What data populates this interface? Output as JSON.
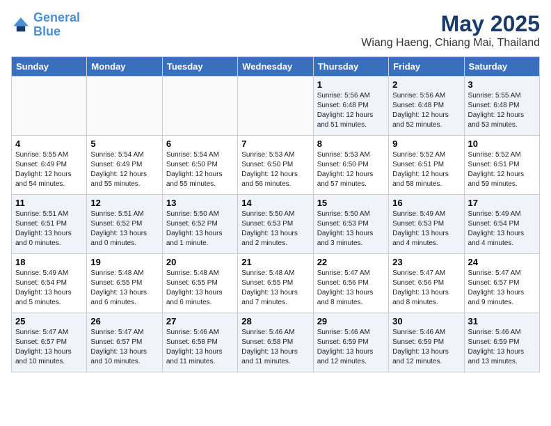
{
  "logo": {
    "line1": "General",
    "line2": "Blue"
  },
  "title": "May 2025",
  "subtitle": "Wiang Haeng, Chiang Mai, Thailand",
  "days_of_week": [
    "Sunday",
    "Monday",
    "Tuesday",
    "Wednesday",
    "Thursday",
    "Friday",
    "Saturday"
  ],
  "weeks": [
    [
      {
        "day": "",
        "info": ""
      },
      {
        "day": "",
        "info": ""
      },
      {
        "day": "",
        "info": ""
      },
      {
        "day": "",
        "info": ""
      },
      {
        "day": "1",
        "info": "Sunrise: 5:56 AM\nSunset: 6:48 PM\nDaylight: 12 hours and 51 minutes."
      },
      {
        "day": "2",
        "info": "Sunrise: 5:56 AM\nSunset: 6:48 PM\nDaylight: 12 hours and 52 minutes."
      },
      {
        "day": "3",
        "info": "Sunrise: 5:55 AM\nSunset: 6:48 PM\nDaylight: 12 hours and 53 minutes."
      }
    ],
    [
      {
        "day": "4",
        "info": "Sunrise: 5:55 AM\nSunset: 6:49 PM\nDaylight: 12 hours and 54 minutes."
      },
      {
        "day": "5",
        "info": "Sunrise: 5:54 AM\nSunset: 6:49 PM\nDaylight: 12 hours and 55 minutes."
      },
      {
        "day": "6",
        "info": "Sunrise: 5:54 AM\nSunset: 6:50 PM\nDaylight: 12 hours and 55 minutes."
      },
      {
        "day": "7",
        "info": "Sunrise: 5:53 AM\nSunset: 6:50 PM\nDaylight: 12 hours and 56 minutes."
      },
      {
        "day": "8",
        "info": "Sunrise: 5:53 AM\nSunset: 6:50 PM\nDaylight: 12 hours and 57 minutes."
      },
      {
        "day": "9",
        "info": "Sunrise: 5:52 AM\nSunset: 6:51 PM\nDaylight: 12 hours and 58 minutes."
      },
      {
        "day": "10",
        "info": "Sunrise: 5:52 AM\nSunset: 6:51 PM\nDaylight: 12 hours and 59 minutes."
      }
    ],
    [
      {
        "day": "11",
        "info": "Sunrise: 5:51 AM\nSunset: 6:51 PM\nDaylight: 13 hours and 0 minutes."
      },
      {
        "day": "12",
        "info": "Sunrise: 5:51 AM\nSunset: 6:52 PM\nDaylight: 13 hours and 0 minutes."
      },
      {
        "day": "13",
        "info": "Sunrise: 5:50 AM\nSunset: 6:52 PM\nDaylight: 13 hours and 1 minute."
      },
      {
        "day": "14",
        "info": "Sunrise: 5:50 AM\nSunset: 6:53 PM\nDaylight: 13 hours and 2 minutes."
      },
      {
        "day": "15",
        "info": "Sunrise: 5:50 AM\nSunset: 6:53 PM\nDaylight: 13 hours and 3 minutes."
      },
      {
        "day": "16",
        "info": "Sunrise: 5:49 AM\nSunset: 6:53 PM\nDaylight: 13 hours and 4 minutes."
      },
      {
        "day": "17",
        "info": "Sunrise: 5:49 AM\nSunset: 6:54 PM\nDaylight: 13 hours and 4 minutes."
      }
    ],
    [
      {
        "day": "18",
        "info": "Sunrise: 5:49 AM\nSunset: 6:54 PM\nDaylight: 13 hours and 5 minutes."
      },
      {
        "day": "19",
        "info": "Sunrise: 5:48 AM\nSunset: 6:55 PM\nDaylight: 13 hours and 6 minutes."
      },
      {
        "day": "20",
        "info": "Sunrise: 5:48 AM\nSunset: 6:55 PM\nDaylight: 13 hours and 6 minutes."
      },
      {
        "day": "21",
        "info": "Sunrise: 5:48 AM\nSunset: 6:55 PM\nDaylight: 13 hours and 7 minutes."
      },
      {
        "day": "22",
        "info": "Sunrise: 5:47 AM\nSunset: 6:56 PM\nDaylight: 13 hours and 8 minutes."
      },
      {
        "day": "23",
        "info": "Sunrise: 5:47 AM\nSunset: 6:56 PM\nDaylight: 13 hours and 8 minutes."
      },
      {
        "day": "24",
        "info": "Sunrise: 5:47 AM\nSunset: 6:57 PM\nDaylight: 13 hours and 9 minutes."
      }
    ],
    [
      {
        "day": "25",
        "info": "Sunrise: 5:47 AM\nSunset: 6:57 PM\nDaylight: 13 hours and 10 minutes."
      },
      {
        "day": "26",
        "info": "Sunrise: 5:47 AM\nSunset: 6:57 PM\nDaylight: 13 hours and 10 minutes."
      },
      {
        "day": "27",
        "info": "Sunrise: 5:46 AM\nSunset: 6:58 PM\nDaylight: 13 hours and 11 minutes."
      },
      {
        "day": "28",
        "info": "Sunrise: 5:46 AM\nSunset: 6:58 PM\nDaylight: 13 hours and 11 minutes."
      },
      {
        "day": "29",
        "info": "Sunrise: 5:46 AM\nSunset: 6:59 PM\nDaylight: 13 hours and 12 minutes."
      },
      {
        "day": "30",
        "info": "Sunrise: 5:46 AM\nSunset: 6:59 PM\nDaylight: 13 hours and 12 minutes."
      },
      {
        "day": "31",
        "info": "Sunrise: 5:46 AM\nSunset: 6:59 PM\nDaylight: 13 hours and 13 minutes."
      }
    ]
  ]
}
